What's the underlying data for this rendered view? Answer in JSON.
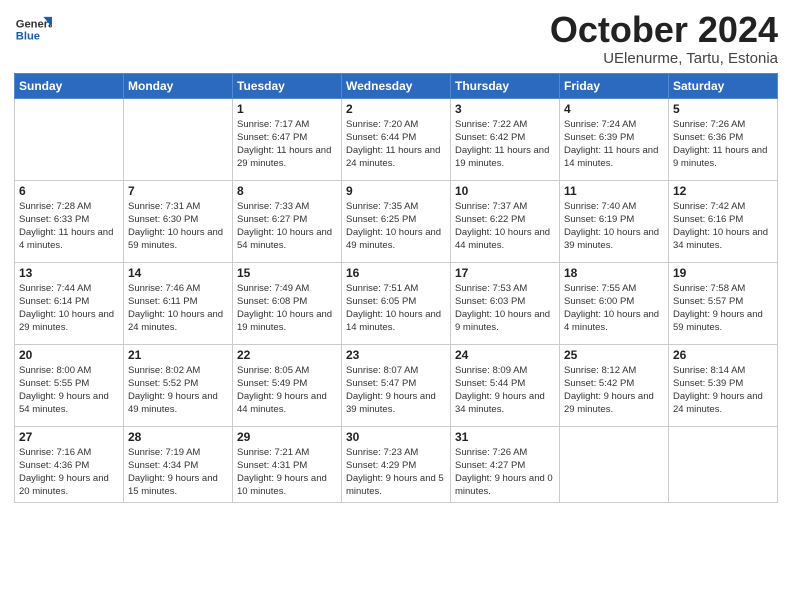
{
  "logo": {
    "general": "General",
    "blue": "Blue"
  },
  "title": "October 2024",
  "subtitle": "UElenurme, Tartu, Estonia",
  "weekdays": [
    "Sunday",
    "Monday",
    "Tuesday",
    "Wednesday",
    "Thursday",
    "Friday",
    "Saturday"
  ],
  "weeks": [
    [
      {
        "day": null
      },
      {
        "day": null
      },
      {
        "day": "1",
        "sunrise": "Sunrise: 7:17 AM",
        "sunset": "Sunset: 6:47 PM",
        "daylight": "Daylight: 11 hours and 29 minutes."
      },
      {
        "day": "2",
        "sunrise": "Sunrise: 7:20 AM",
        "sunset": "Sunset: 6:44 PM",
        "daylight": "Daylight: 11 hours and 24 minutes."
      },
      {
        "day": "3",
        "sunrise": "Sunrise: 7:22 AM",
        "sunset": "Sunset: 6:42 PM",
        "daylight": "Daylight: 11 hours and 19 minutes."
      },
      {
        "day": "4",
        "sunrise": "Sunrise: 7:24 AM",
        "sunset": "Sunset: 6:39 PM",
        "daylight": "Daylight: 11 hours and 14 minutes."
      },
      {
        "day": "5",
        "sunrise": "Sunrise: 7:26 AM",
        "sunset": "Sunset: 6:36 PM",
        "daylight": "Daylight: 11 hours and 9 minutes."
      }
    ],
    [
      {
        "day": "6",
        "sunrise": "Sunrise: 7:28 AM",
        "sunset": "Sunset: 6:33 PM",
        "daylight": "Daylight: 11 hours and 4 minutes."
      },
      {
        "day": "7",
        "sunrise": "Sunrise: 7:31 AM",
        "sunset": "Sunset: 6:30 PM",
        "daylight": "Daylight: 10 hours and 59 minutes."
      },
      {
        "day": "8",
        "sunrise": "Sunrise: 7:33 AM",
        "sunset": "Sunset: 6:27 PM",
        "daylight": "Daylight: 10 hours and 54 minutes."
      },
      {
        "day": "9",
        "sunrise": "Sunrise: 7:35 AM",
        "sunset": "Sunset: 6:25 PM",
        "daylight": "Daylight: 10 hours and 49 minutes."
      },
      {
        "day": "10",
        "sunrise": "Sunrise: 7:37 AM",
        "sunset": "Sunset: 6:22 PM",
        "daylight": "Daylight: 10 hours and 44 minutes."
      },
      {
        "day": "11",
        "sunrise": "Sunrise: 7:40 AM",
        "sunset": "Sunset: 6:19 PM",
        "daylight": "Daylight: 10 hours and 39 minutes."
      },
      {
        "day": "12",
        "sunrise": "Sunrise: 7:42 AM",
        "sunset": "Sunset: 6:16 PM",
        "daylight": "Daylight: 10 hours and 34 minutes."
      }
    ],
    [
      {
        "day": "13",
        "sunrise": "Sunrise: 7:44 AM",
        "sunset": "Sunset: 6:14 PM",
        "daylight": "Daylight: 10 hours and 29 minutes."
      },
      {
        "day": "14",
        "sunrise": "Sunrise: 7:46 AM",
        "sunset": "Sunset: 6:11 PM",
        "daylight": "Daylight: 10 hours and 24 minutes."
      },
      {
        "day": "15",
        "sunrise": "Sunrise: 7:49 AM",
        "sunset": "Sunset: 6:08 PM",
        "daylight": "Daylight: 10 hours and 19 minutes."
      },
      {
        "day": "16",
        "sunrise": "Sunrise: 7:51 AM",
        "sunset": "Sunset: 6:05 PM",
        "daylight": "Daylight: 10 hours and 14 minutes."
      },
      {
        "day": "17",
        "sunrise": "Sunrise: 7:53 AM",
        "sunset": "Sunset: 6:03 PM",
        "daylight": "Daylight: 10 hours and 9 minutes."
      },
      {
        "day": "18",
        "sunrise": "Sunrise: 7:55 AM",
        "sunset": "Sunset: 6:00 PM",
        "daylight": "Daylight: 10 hours and 4 minutes."
      },
      {
        "day": "19",
        "sunrise": "Sunrise: 7:58 AM",
        "sunset": "Sunset: 5:57 PM",
        "daylight": "Daylight: 9 hours and 59 minutes."
      }
    ],
    [
      {
        "day": "20",
        "sunrise": "Sunrise: 8:00 AM",
        "sunset": "Sunset: 5:55 PM",
        "daylight": "Daylight: 9 hours and 54 minutes."
      },
      {
        "day": "21",
        "sunrise": "Sunrise: 8:02 AM",
        "sunset": "Sunset: 5:52 PM",
        "daylight": "Daylight: 9 hours and 49 minutes."
      },
      {
        "day": "22",
        "sunrise": "Sunrise: 8:05 AM",
        "sunset": "Sunset: 5:49 PM",
        "daylight": "Daylight: 9 hours and 44 minutes."
      },
      {
        "day": "23",
        "sunrise": "Sunrise: 8:07 AM",
        "sunset": "Sunset: 5:47 PM",
        "daylight": "Daylight: 9 hours and 39 minutes."
      },
      {
        "day": "24",
        "sunrise": "Sunrise: 8:09 AM",
        "sunset": "Sunset: 5:44 PM",
        "daylight": "Daylight: 9 hours and 34 minutes."
      },
      {
        "day": "25",
        "sunrise": "Sunrise: 8:12 AM",
        "sunset": "Sunset: 5:42 PM",
        "daylight": "Daylight: 9 hours and 29 minutes."
      },
      {
        "day": "26",
        "sunrise": "Sunrise: 8:14 AM",
        "sunset": "Sunset: 5:39 PM",
        "daylight": "Daylight: 9 hours and 24 minutes."
      }
    ],
    [
      {
        "day": "27",
        "sunrise": "Sunrise: 7:16 AM",
        "sunset": "Sunset: 4:36 PM",
        "daylight": "Daylight: 9 hours and 20 minutes."
      },
      {
        "day": "28",
        "sunrise": "Sunrise: 7:19 AM",
        "sunset": "Sunset: 4:34 PM",
        "daylight": "Daylight: 9 hours and 15 minutes."
      },
      {
        "day": "29",
        "sunrise": "Sunrise: 7:21 AM",
        "sunset": "Sunset: 4:31 PM",
        "daylight": "Daylight: 9 hours and 10 minutes."
      },
      {
        "day": "30",
        "sunrise": "Sunrise: 7:23 AM",
        "sunset": "Sunset: 4:29 PM",
        "daylight": "Daylight: 9 hours and 5 minutes."
      },
      {
        "day": "31",
        "sunrise": "Sunrise: 7:26 AM",
        "sunset": "Sunset: 4:27 PM",
        "daylight": "Daylight: 9 hours and 0 minutes."
      },
      {
        "day": null
      },
      {
        "day": null
      }
    ]
  ]
}
